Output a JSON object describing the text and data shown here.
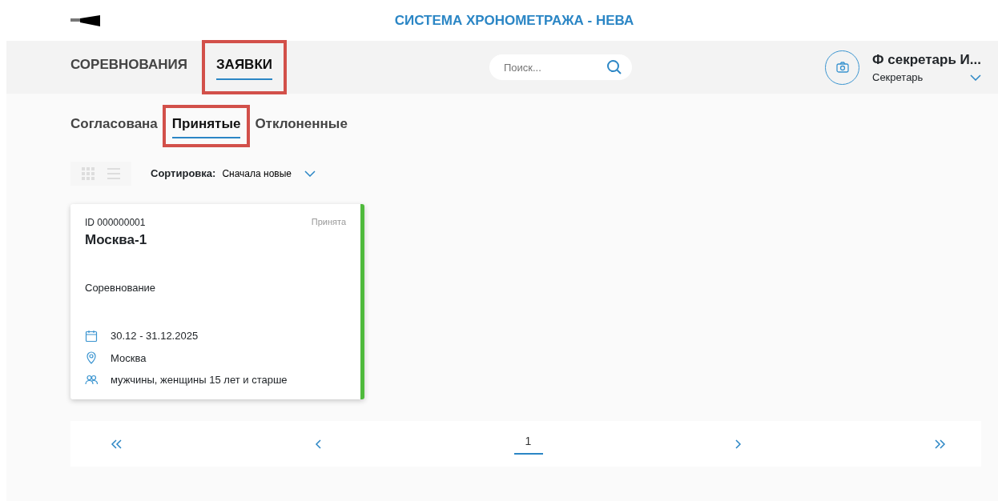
{
  "header": {
    "title": "СИСТЕМА ХРОНОМЕТРАЖА - НЕВА"
  },
  "nav": {
    "items": [
      {
        "label": "СОРЕВНОВАНИЯ",
        "selected": false,
        "highlighted": false
      },
      {
        "label": "ЗАЯВКИ",
        "selected": true,
        "highlighted": true
      }
    ]
  },
  "search": {
    "placeholder": "Поиск..."
  },
  "user": {
    "name": "Ф секретарь И...",
    "role": "Секретарь"
  },
  "subtabs": [
    {
      "label": "Согласована",
      "selected": false,
      "highlighted": false
    },
    {
      "label": "Принятые",
      "selected": true,
      "highlighted": true
    },
    {
      "label": "Отклоненные",
      "selected": false,
      "highlighted": false
    }
  ],
  "sort": {
    "label": "Сортировка:",
    "value": "Сначала новые"
  },
  "cards": [
    {
      "id": "ID 000000001",
      "status": "Принята",
      "color": "#4fba3c",
      "title": "Москва-1",
      "type": "Соревнование",
      "details": [
        {
          "kind": "date",
          "text": "30.12 - 31.12.2025"
        },
        {
          "kind": "place",
          "text": "Москва"
        },
        {
          "kind": "people",
          "text": "мужчины, женщины 15 лет и старше"
        }
      ]
    }
  ],
  "pagination": {
    "pages": [
      {
        "label": "1",
        "selected": true
      }
    ]
  }
}
